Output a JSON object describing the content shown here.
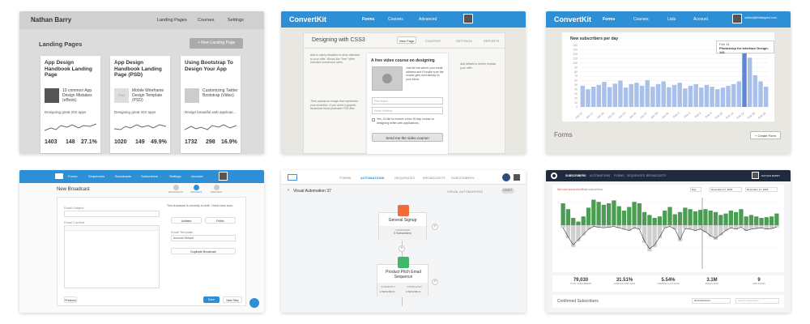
{
  "tile1": {
    "user_name": "Nathan Barry",
    "nav": [
      "Landing Pages",
      "Courses",
      "Settings"
    ],
    "page_title": "Landing Pages",
    "new_button": "+ New Landing Page",
    "cards": [
      {
        "title": "App Design Handbook Landing Page",
        "thumb": "",
        "body": "10 common App Design Mistakes (eBook)",
        "caption": "Designing great iOS apps",
        "stats": [
          "1403",
          "148",
          "27.1%"
        ]
      },
      {
        "title": "App Design Handbook Landing Page (PSD)",
        "thumb": "PSD",
        "body": "Mobile Wireframe Design Template (PSD)",
        "caption": "Designing great iOS apps",
        "stats": [
          "1020",
          "149",
          "49.9%"
        ]
      },
      {
        "title": "Using Bootstrap To Design Your App",
        "thumb": "",
        "body": "Customizing Twitter Bootstrap (Video)",
        "caption": "Design beautiful web applicati...",
        "stats": [
          "1732",
          "298",
          "16.9%"
        ]
      }
    ]
  },
  "tile2": {
    "brand": "ConvertKit",
    "nav": [
      "Forms",
      "Courses",
      "Advanced"
    ],
    "form_title": "Designing with CSS3",
    "view_button": "View Page",
    "tabs": [
      "CONTENT",
      "SETTINGS",
      "REPORTS"
    ],
    "promo_heading": "A free video course on designing",
    "promo_body": "Just tell me where your email address and I'll make sure the course gets sent directly to your inbox.",
    "field_first": "First Name",
    "field_email": "Email Address",
    "checkbox_text": "Yes, I'd like to receive a free 30 day course on designing better web applications.",
    "submit": "Send me the video course!",
    "note_left_top": "Add a catchy headline to draw attention to your offer. Words like \"free\" often increase conversion rates.",
    "note_left_bottom": "Then upload an image that represents your incentive. If you need a graphic, download these premade PSD files.",
    "note_right": "Add details to further explain your offer."
  },
  "tile3": {
    "brand": "ConvertKit",
    "nav": [
      "Forms",
      "Courses",
      "Lists",
      "Account"
    ],
    "user_email": "nathan@thinklegend.com",
    "chart_heading": "New subscribers per day",
    "tooltip_date": "Feb 14",
    "tooltip_text": "Photoshop for Interface Design: 141",
    "section_title": "Forms",
    "create_button": "+ Create Form",
    "chart_data": {
      "type": "bar",
      "title": "New subscribers per day",
      "categories": [
        "Jan 15",
        "",
        "Jan 17",
        "",
        "Jan 19",
        "",
        "Jan 21",
        "",
        "Jan 23",
        "",
        "Jan 25",
        "",
        "Jan 27",
        "",
        "Jan 29",
        "",
        "Jan 31",
        "",
        "Feb 2",
        "",
        "Feb 4",
        "",
        "Feb 6",
        "",
        "Feb 8",
        "",
        "Feb 10",
        "",
        "Feb 12",
        "",
        "Feb 14",
        "",
        "Feb 16",
        "",
        "Feb 18"
      ],
      "values": [
        48,
        40,
        46,
        50,
        57,
        45,
        53,
        60,
        44,
        52,
        55,
        48,
        61,
        46,
        52,
        58,
        45,
        50,
        55,
        42,
        48,
        52,
        44,
        50,
        46,
        40,
        44,
        48,
        52,
        58,
        141,
        112,
        72,
        58,
        46
      ],
      "ylim": [
        0,
        140
      ],
      "yticks": [
        0,
        10,
        20,
        30,
        40,
        50,
        60,
        70,
        80,
        90,
        100,
        110,
        120,
        130,
        140
      ],
      "highlight": "Feb 14"
    }
  },
  "tile4": {
    "nav": [
      "Forms",
      "Sequences",
      "Broadcasts",
      "Subscribers",
      "Settings",
      "Account"
    ],
    "title": "New Broadcast",
    "steps": [
      "RECIPIENTS",
      "CONTENT",
      "PREVIEW"
    ],
    "label_subject": "Email Subject",
    "label_content": "Email Content",
    "notice": "This broadcast is currently in draft. Check back soon.",
    "opt_a": "Unlisted",
    "opt_b": "Public",
    "label_template": "Email Template",
    "select_value": "Account Default",
    "dup_button": "Duplicate Broadcast",
    "back": "Previous",
    "save": "Save",
    "next": "Next Step"
  },
  "tile5": {
    "nav": [
      "FORMS",
      "AUTOMATIONS",
      "SEQUENCES",
      "BROADCASTS",
      "SUBSCRIBERS"
    ],
    "title": "Visual Automation 37",
    "right_label": "VISUAL AUTOMATIONS",
    "toggle": "DRAFT",
    "node1_title": "General Signup",
    "node1_status": "COMPLETED",
    "node1_count": "0 Subscribers",
    "node2_title": "Product Pitch Email Sequence",
    "node2_status_a": "CURRENTLY",
    "node2_status_b": "COMPLETED",
    "node2_count_a": "0 Subscribers",
    "node2_count_b": "0 Subscribers"
  },
  "tile6": {
    "nav": [
      "SUBSCRIBERS",
      "AUTOMATIONS",
      "FORMS",
      "SEQUENCES",
      "BROADCASTS"
    ],
    "user": "NATHAN BARRY",
    "tab_new": "Net new subscribers",
    "tab_total": "Total subscribers",
    "range_start": "November 17, 2018",
    "range_end": "December 17, 2018",
    "zoom": "Day",
    "stats": [
      {
        "value": "79,030",
        "label": "TOTAL SUBSCRIBERS"
      },
      {
        "value": "31.51%",
        "label": "AVERAGE OPEN RATE"
      },
      {
        "value": "5.54%",
        "label": "AVERAGE CLICK RATE"
      },
      {
        "value": "3.1M",
        "label": "EMAILS SENT"
      },
      {
        "value": "9",
        "label": "NEW FORMS"
      }
    ],
    "section_title": "Confirmed Subscribers",
    "search_placeholder": "Search subscribers",
    "filter": "All Subscribers",
    "chart_data": {
      "type": "bar",
      "series": [
        {
          "name": "new",
          "values": [
            30,
            22,
            10,
            5,
            12,
            24,
            35,
            32,
            28,
            30,
            34,
            26,
            20,
            25,
            32,
            30,
            18,
            14,
            10,
            12,
            20,
            25,
            15,
            18,
            24,
            22,
            19,
            21,
            22,
            20,
            18,
            14,
            16,
            20,
            18,
            22,
            12,
            14,
            12,
            10,
            11,
            12,
            16
          ]
        },
        {
          "name": "unsub",
          "values": [
            -4,
            -18,
            -30,
            -22,
            -14,
            -6,
            -2,
            -3,
            -4,
            -3,
            -2,
            -4,
            -6,
            -8,
            -4,
            -6,
            -24,
            -36,
            -30,
            -18,
            -4,
            -2,
            -6,
            -22,
            -5,
            -6,
            -8,
            -6,
            -10,
            -16,
            -20,
            -14,
            -8,
            -4,
            -6,
            -3,
            -8,
            -6,
            -5,
            -4,
            -6,
            -5,
            -3
          ]
        }
      ]
    }
  }
}
